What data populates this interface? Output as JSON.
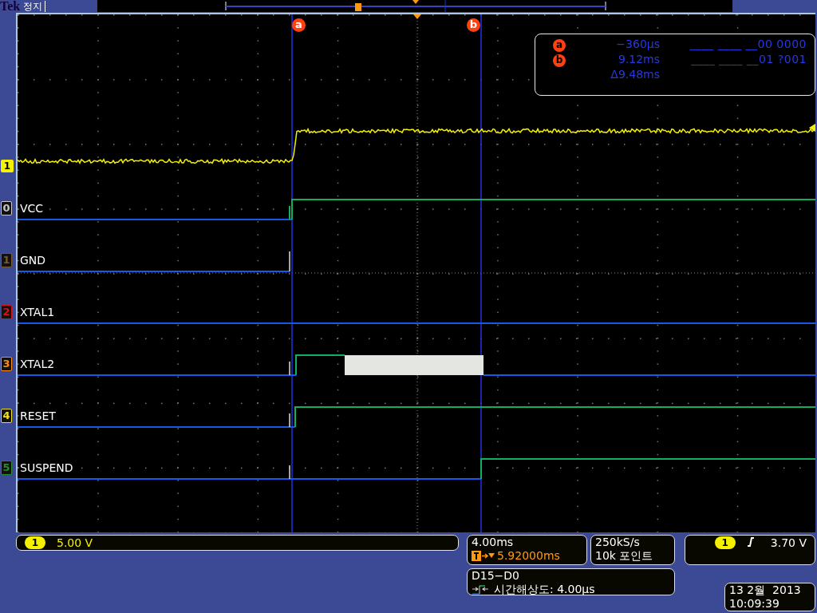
{
  "brand": "Tek",
  "status": "정지",
  "cursor_markers": [
    {
      "label": "a"
    },
    {
      "label": "b"
    }
  ],
  "cursors": [
    {
      "label": "a",
      "time": "−360µs",
      "bits": "____ ____ __00 0000"
    },
    {
      "label": "b",
      "time": "9.12ms",
      "bits": "____ ____ __01 ?001"
    }
  ],
  "delta": "Δ9.48ms",
  "analog": {
    "number": "1",
    "badge": "1",
    "scale": "5.00 V"
  },
  "digital": [
    {
      "number": "0",
      "name": "VCC",
      "color": "#c8c8c8",
      "kind": "rise_a"
    },
    {
      "number": "1",
      "name": "GND",
      "color": "#7a5a2a",
      "kind": "end_a"
    },
    {
      "number": "2",
      "name": "XTAL1",
      "color": "#e01010",
      "kind": "low"
    },
    {
      "number": "3",
      "name": "XTAL2",
      "color": "#ff8a10",
      "kind": "burst"
    },
    {
      "number": "4",
      "name": "RESET",
      "color": "#f0e020",
      "kind": "rise_late"
    },
    {
      "number": "5",
      "name": "SUSPEND",
      "color": "#2a8a2a",
      "kind": "rise_b"
    }
  ],
  "timebase": {
    "scale": "4.00ms",
    "position": "5.92000ms"
  },
  "acquisition": {
    "rate": "250kS/s",
    "length": "10k 포인트"
  },
  "trigger": {
    "source": "1",
    "level": "3.70 V"
  },
  "digital_group": {
    "label": "D15−D0",
    "resolution": "시간해상도: 4.00µs"
  },
  "date": "13 2월  2013",
  "time": "10:09:39"
}
